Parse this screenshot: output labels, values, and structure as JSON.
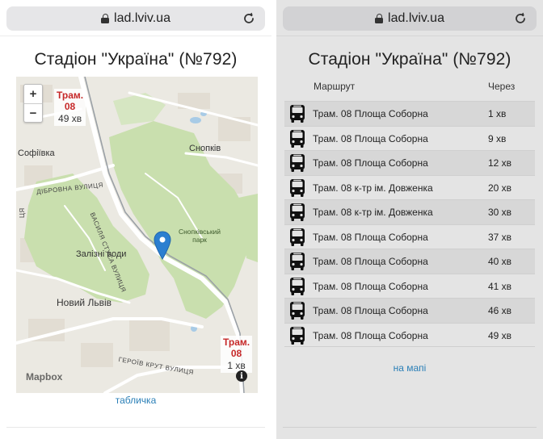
{
  "browser": {
    "url": "lad.lviv.ua"
  },
  "stop": {
    "title": "Стадіон \"Україна\" (№792)"
  },
  "map_view": {
    "zoom_in": "+",
    "zoom_out": "−",
    "markers": [
      {
        "type": "Трам.",
        "route": "08",
        "eta": "49 хв"
      },
      {
        "type": "Трам.",
        "route": "08",
        "eta": "1 хв"
      }
    ],
    "labels": {
      "sofiivka": "Софіївка",
      "snopkiv": "Снопків",
      "dibrovna": "ДІБРОВНА ВУЛИЦЯ",
      "stusa": "ВАСИЛЯ СТУСА ВУЛИЦЯ",
      "park": "Снопківський парк",
      "zalizni_vody": "Залізні води",
      "novyi_lviv": "Новий Львів",
      "heroiv_krut": "ГЕРОЇВ КРУТ ВУЛИЦЯ",
      "edge_tsia": "ЦЯ"
    },
    "attribution": "Mapbox",
    "info_symbol": "i",
    "switch_link": "табличка"
  },
  "table_view": {
    "headers": {
      "route": "Маршрут",
      "eta": "Через"
    },
    "rows": [
      {
        "route": "Трам. 08 Площа Соборна",
        "eta": "1 хв"
      },
      {
        "route": "Трам. 08 Площа Соборна",
        "eta": "9 хв"
      },
      {
        "route": "Трам. 08 Площа Соборна",
        "eta": "12 хв"
      },
      {
        "route": "Трам. 08 к-тр ім. Довженка",
        "eta": "20 хв"
      },
      {
        "route": "Трам. 08 к-тр ім. Довженка",
        "eta": "30 хв"
      },
      {
        "route": "Трам. 08 Площа Соборна",
        "eta": "37 хв"
      },
      {
        "route": "Трам. 08 Площа Соборна",
        "eta": "40 хв"
      },
      {
        "route": "Трам. 08 Площа Соборна",
        "eta": "41 хв"
      },
      {
        "route": "Трам. 08 Площа Соборна",
        "eta": "46 хв"
      },
      {
        "route": "Трам. 08 Площа Соборна",
        "eta": "49 хв"
      }
    ],
    "switch_link": "на мапі"
  },
  "colors": {
    "link": "#2a7fb7",
    "marker_red": "#c62828",
    "pin_blue": "#2b7fd0",
    "park_green": "#c9dfae"
  },
  "icons": {
    "bus": "bus-icon",
    "lock": "lock-icon",
    "reload": "reload-icon",
    "pin": "map-pin-icon",
    "info": "info-icon"
  }
}
